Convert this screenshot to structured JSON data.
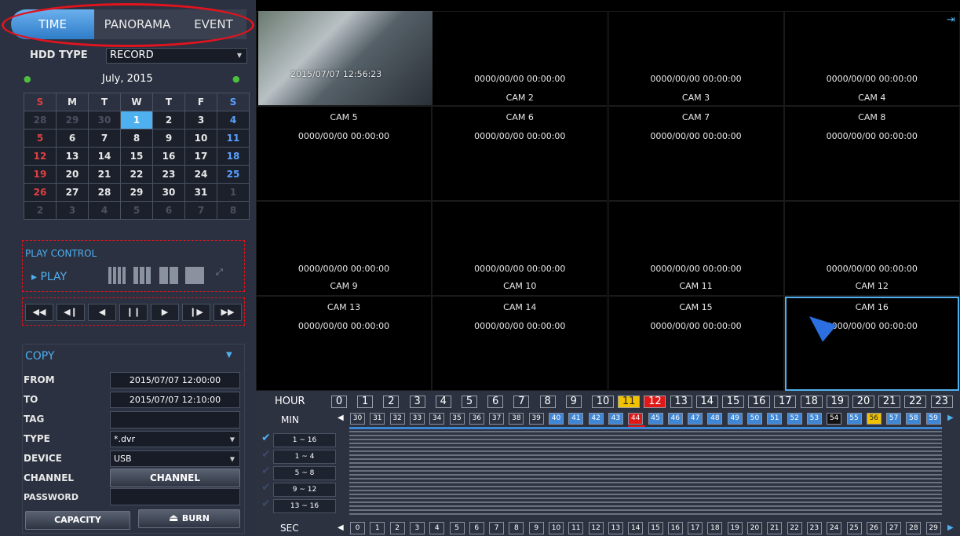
{
  "tabs": [
    "TIME",
    "PANORAMA",
    "EVENT"
  ],
  "hdd": {
    "label": "HDD TYPE",
    "value": "RECORD"
  },
  "calendar": {
    "title": "July, 2015",
    "weekdays": [
      "S",
      "M",
      "T",
      "W",
      "T",
      "F",
      "S"
    ],
    "weeks": [
      [
        "28",
        "29",
        "30",
        "1",
        "2",
        "3",
        "4"
      ],
      [
        "5",
        "6",
        "7",
        "8",
        "9",
        "10",
        "11"
      ],
      [
        "12",
        "13",
        "14",
        "15",
        "16",
        "17",
        "18"
      ],
      [
        "19",
        "20",
        "21",
        "22",
        "23",
        "24",
        "25"
      ],
      [
        "26",
        "27",
        "28",
        "29",
        "30",
        "31",
        "1"
      ],
      [
        "2",
        "3",
        "4",
        "5",
        "6",
        "7",
        "8"
      ]
    ],
    "selected": "1"
  },
  "play_control": {
    "title": "PLAY CONTROL",
    "play_label": "PLAY"
  },
  "playback": [
    "◀◀",
    "◀❙",
    "◀",
    "❙❙",
    "▶",
    "❙▶",
    "▶▶"
  ],
  "copy": {
    "title": "COPY",
    "from_label": "FROM",
    "from": "2015/07/07 12:00:00",
    "to_label": "TO",
    "to": "2015/07/07 12:10:00",
    "tag_label": "TAG",
    "tag": "",
    "type_label": "TYPE",
    "type": "*.dvr",
    "device_label": "DEVICE",
    "device": "USB",
    "channel_label": "CHANNEL",
    "channel_button": "CHANNEL",
    "password_label": "PASSWORD",
    "capacity_button": "CAPACITY",
    "burn_button": "BURN"
  },
  "cameras": [
    {
      "name": "",
      "ts": ""
    },
    {
      "name": "CAM 2",
      "ts": "0000/00/00 00:00:00"
    },
    {
      "name": "CAM 3",
      "ts": "0000/00/00 00:00:00"
    },
    {
      "name": "CAM 4",
      "ts": "0000/00/00 00:00:00"
    },
    {
      "name": "CAM 5",
      "ts": "0000/00/00 00:00:00"
    },
    {
      "name": "CAM 6",
      "ts": "0000/00/00 00:00:00"
    },
    {
      "name": "CAM 7",
      "ts": "0000/00/00 00:00:00"
    },
    {
      "name": "CAM 8",
      "ts": "0000/00/00 00:00:00"
    },
    {
      "name": "CAM 9",
      "ts": "0000/00/00 00:00:00"
    },
    {
      "name": "CAM 10",
      "ts": "0000/00/00 00:00:00"
    },
    {
      "name": "CAM 11",
      "ts": "0000/00/00 00:00:00"
    },
    {
      "name": "CAM 12",
      "ts": "0000/00/00 00:00:00"
    },
    {
      "name": "CAM 13",
      "ts": "0000/00/00 00:00:00"
    },
    {
      "name": "CAM 14",
      "ts": "0000/00/00 00:00:00"
    },
    {
      "name": "CAM 15",
      "ts": "0000/00/00 00:00:00"
    },
    {
      "name": "CAM 16",
      "ts": "0000/00/00 00:00:00"
    }
  ],
  "cam1_overlay": "2015/07/07 12:56:23",
  "timeline": {
    "hour_label": "HOUR",
    "min_label": "MIN",
    "sec_label": "SEC",
    "hours": [
      "0",
      "1",
      "2",
      "3",
      "4",
      "5",
      "6",
      "7",
      "8",
      "9",
      "10",
      "11",
      "12",
      "13",
      "14",
      "15",
      "16",
      "17",
      "18",
      "19",
      "20",
      "21",
      "22",
      "23"
    ],
    "minutes": [
      "30",
      "31",
      "32",
      "33",
      "34",
      "35",
      "36",
      "37",
      "38",
      "39",
      "40",
      "41",
      "42",
      "43",
      "44",
      "45",
      "46",
      "47",
      "48",
      "49",
      "50",
      "51",
      "52",
      "53",
      "54",
      "55",
      "56",
      "57",
      "58",
      "59"
    ],
    "seconds": [
      "0",
      "1",
      "2",
      "3",
      "4",
      "5",
      "6",
      "7",
      "8",
      "9",
      "10",
      "11",
      "12",
      "13",
      "14",
      "15",
      "16",
      "17",
      "18",
      "19",
      "20",
      "21",
      "22",
      "23",
      "24",
      "25",
      "26",
      "27",
      "28",
      "29"
    ],
    "channels": [
      "1 ~ 16",
      "1 ~ 4",
      "5 ~ 8",
      "9 ~ 12",
      "13 ~ 16"
    ]
  },
  "colors": {
    "accent": "#4fb0f0",
    "hour_highlight_yellow": "#f2c200",
    "hour_highlight_red": "#e01818",
    "minute_recorded": "#3e86d6",
    "annotation_red": "#e0141e"
  }
}
